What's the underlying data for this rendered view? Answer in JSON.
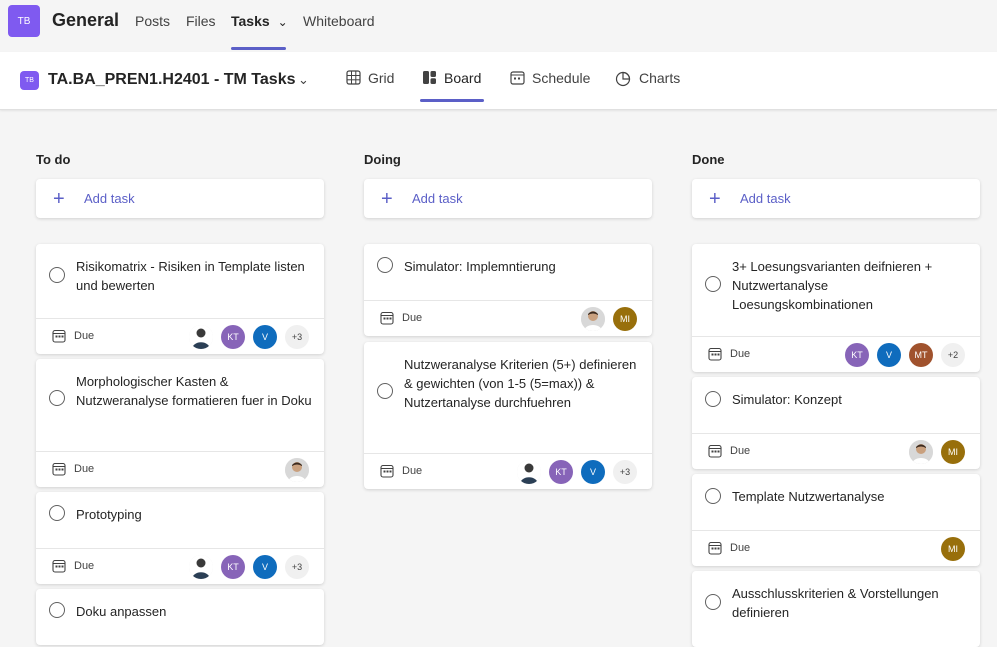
{
  "header": {
    "team_initials": "TB",
    "team_name": "General",
    "tabs": [
      "Posts",
      "Files",
      "Tasks",
      "Whiteboard"
    ]
  },
  "plan": {
    "icon_initials": "TB",
    "title": "TA.BA_PREN1.H2401 - TM Tasks",
    "views": [
      "Grid",
      "Board",
      "Schedule",
      "Charts"
    ],
    "active_view": "Board"
  },
  "colors": {
    "accent": "#5b5fc7",
    "team": "#7f5af0",
    "kt": "#8764b8",
    "v": "#0f6cbd",
    "mt": "#a0522d",
    "mi": "#986f0b"
  },
  "board": {
    "add_task_label": "Add task",
    "due_label": "Due",
    "columns": [
      {
        "title": "To do",
        "cards": [
          {
            "title": "Risikomatrix - Risiken in Template listen und bewerten",
            "assignees": [
              "KT",
              "V"
            ],
            "more": "+3"
          },
          {
            "title": "Morphologischer Kasten & Nutzweranalyse formatieren fuer in Doku"
          },
          {
            "title": "Prototyping",
            "assignees": [
              "KT",
              "V"
            ],
            "more": "+3"
          },
          {
            "title": "Doku anpassen"
          }
        ]
      },
      {
        "title": "Doing",
        "cards": [
          {
            "title": "Simulator: Implemntierung",
            "assignees": [
              "MI"
            ]
          },
          {
            "title": "Nutzweranalyse Kriterien (5+) definieren & gewichten (von 1-5 (5=max)) & Nutzertanalyse durchfuehren",
            "assignees": [
              "KT",
              "V"
            ],
            "more": "+3"
          }
        ]
      },
      {
        "title": "Done",
        "cards": [
          {
            "title": "3+ Loesungsvarianten deifnieren + Nutzwertanalyse Loesungskombinationen",
            "assignees": [
              "KT",
              "V",
              "MT"
            ],
            "more": "+2"
          },
          {
            "title": "Simulator: Konzept",
            "assignees": [
              "MI"
            ]
          },
          {
            "title": "Template Nutzwertanalyse",
            "assignees": [
              "MI"
            ]
          },
          {
            "title": "Ausschlusskriterien & Vorstellungen definieren"
          }
        ]
      }
    ]
  }
}
